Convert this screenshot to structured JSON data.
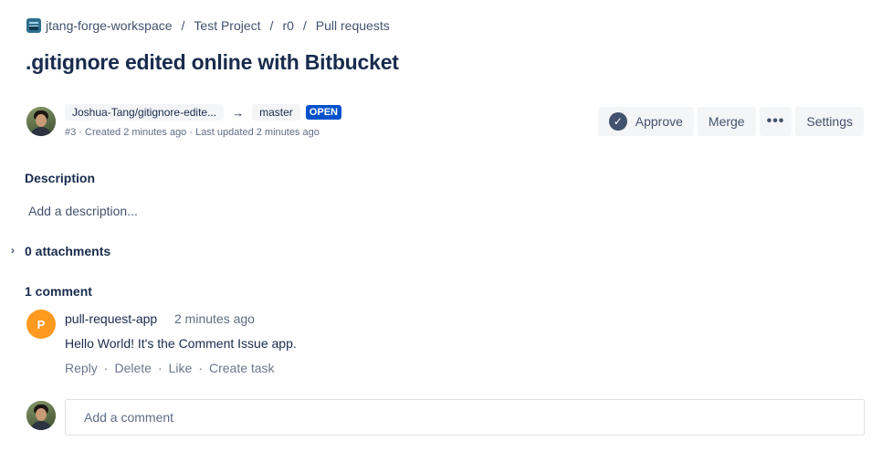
{
  "breadcrumb": {
    "workspace": "jtang-forge-workspace",
    "project": "Test Project",
    "repo": "r0",
    "section": "Pull requests"
  },
  "pr": {
    "title": ".gitignore edited online with Bitbucket",
    "source_branch": "Joshua-Tang/gitignore-edite...",
    "arrow": "→",
    "target_branch": "master",
    "status": "OPEN",
    "subtitle": "#3 · Created 2 minutes ago · Last updated 2 minutes ago",
    "status_color": "#0052cc"
  },
  "actions": {
    "approve": "Approve",
    "approve_glyph": "✓",
    "merge": "Merge",
    "more": "•••",
    "settings": "Settings"
  },
  "description": {
    "label": "Description",
    "placeholder": "Add a description..."
  },
  "attachments": {
    "chevron": "›",
    "label": "0 attachments"
  },
  "comments": {
    "count_label": "1 comment",
    "items": [
      {
        "avatar_initial": "P",
        "avatar_color": "#ff991f",
        "author": "pull-request-app",
        "time": "2 minutes ago",
        "body": "Hello World! It's the Comment Issue app.",
        "actions": [
          "Reply",
          "Delete",
          "Like",
          "Create task"
        ]
      }
    ],
    "new_comment_placeholder": "Add a comment"
  }
}
